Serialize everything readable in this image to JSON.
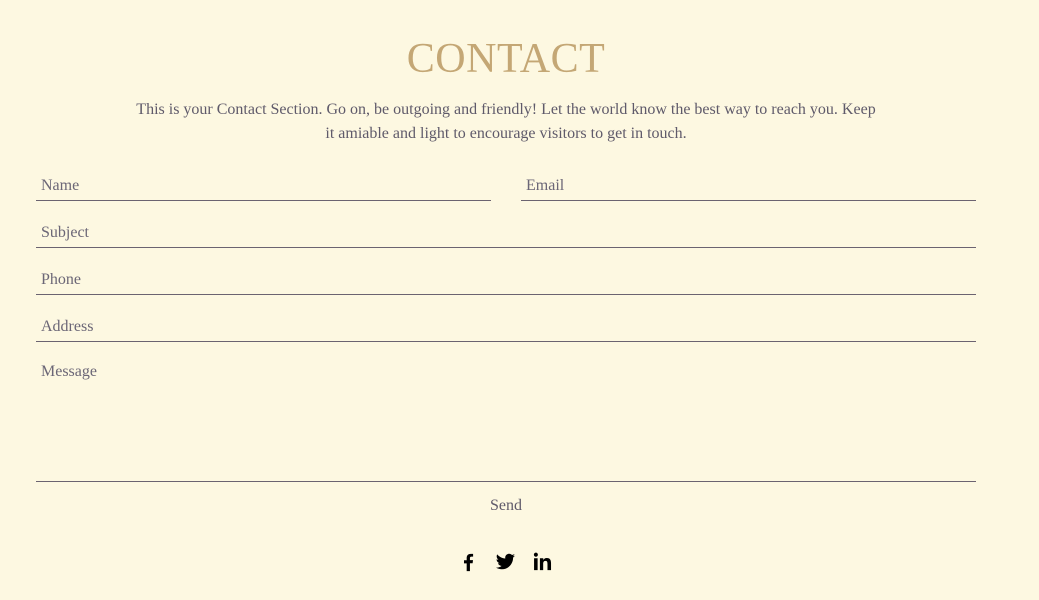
{
  "contact": {
    "title": "CONTACT",
    "intro": "This is your Contact Section. Go on, be outgoing and friendly! Let the world know the best way to reach you. Keep it amiable and light to encourage visitors to get in touch."
  },
  "form": {
    "name_placeholder": "Name",
    "email_placeholder": "Email",
    "subject_placeholder": "Subject",
    "phone_placeholder": "Phone",
    "address_placeholder": "Address",
    "message_placeholder": "Message",
    "send_label": "Send"
  },
  "social": {
    "icons": [
      "facebook-icon",
      "twitter-icon",
      "linkedin-icon"
    ]
  },
  "colors": {
    "background": "#fdf8e1",
    "title": "#c4a775",
    "text": "#5f5a6a",
    "underline": "#6b6370"
  }
}
